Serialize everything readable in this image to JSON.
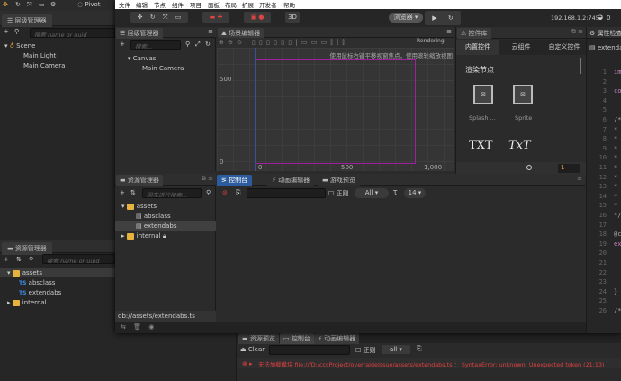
{
  "back_window": {
    "toolbar": {
      "pivot": "Pivot"
    },
    "hierarchy": {
      "title": "层级管理器",
      "search_placeholder": "搜索 name or uuid",
      "tree": [
        "Scene",
        "Main Light",
        "Main Camera"
      ]
    },
    "assets": {
      "title": "资源管理器",
      "search_placeholder": "搜索 name or uuid",
      "tree": [
        {
          "label": "assets",
          "type": "folder"
        },
        {
          "label": "absclass",
          "type": "ts"
        },
        {
          "label": "extendabs",
          "type": "ts"
        },
        {
          "label": "internal",
          "type": "folder"
        }
      ]
    },
    "console": {
      "tabs": [
        "资源预览",
        "控制台",
        "动画编辑器"
      ],
      "clear": "Clear",
      "regex": "正则",
      "level": "all",
      "error": "无法加载模块 file:///D:/cccProject/overraideIssue/assets/extendabs.ts ： SyntaxError: unknown: Unexpected token (21:13)",
      "error_color": "#e04040"
    }
  },
  "front_window": {
    "menu": [
      "文件",
      "编辑",
      "节点",
      "组件",
      "项目",
      "面板",
      "布局",
      "扩展",
      "开发者",
      "帮助"
    ],
    "toolbar": {
      "mode": "3D",
      "preview": "浏览器 ▾",
      "ip": "192.168.1.2:7457",
      "wifi_count": "0"
    },
    "hierarchy": {
      "title": "层级管理器",
      "search_placeholder": "搜索...",
      "tree": [
        "Canvas",
        "Main Camera"
      ]
    },
    "scene": {
      "title": "场景编辑器",
      "rendering": "Rendering",
      "hint": "使用鼠标右键平移视窗焦点，使用滚轮缩放视图",
      "y_labels": [
        "500",
        "0"
      ],
      "x_labels": [
        "0",
        "500",
        "1,000"
      ]
    },
    "library": {
      "title": "控件库",
      "tabs": [
        "内置控件",
        "云组件",
        "自定义控件"
      ],
      "section": "渲染节点",
      "items": [
        "Splash ...",
        "Sprite"
      ],
      "text_items": [
        "TXT",
        "TxT"
      ],
      "scale": "1"
    },
    "inspector": {
      "title": "属性检查器",
      "file": "extendabs",
      "lines": [
        "1",
        "2",
        "3",
        "4",
        "5",
        "6",
        "7",
        "8",
        "9",
        "10",
        "11",
        "12",
        "13",
        "14",
        "15",
        "16",
        "17",
        "18",
        "19",
        "20",
        "21",
        "22",
        "23",
        "24",
        "25",
        "26"
      ],
      "code": {
        "1": "imp",
        "3": "con",
        "6": "/**",
        "7": " *",
        "8": " *",
        "9": " *",
        "10": " *",
        "11": " *",
        "12": " *",
        "13": " *",
        "14": " *",
        "15": " *",
        "16": " */",
        "18": "@cc",
        "19": "exp",
        "24": "}",
        "26": "/**"
      }
    },
    "assets": {
      "title": "资源管理器",
      "search_placeholder": "回车进行搜索...",
      "tree": [
        "assets",
        "absclass",
        "extendabs",
        "internal"
      ],
      "path": "db://assets/extendabs.ts"
    },
    "bottom_tabs": [
      "控制台",
      "动画编辑器",
      "游戏预览"
    ],
    "console": {
      "regex": "正则",
      "level": "All",
      "font_size": "14"
    }
  }
}
